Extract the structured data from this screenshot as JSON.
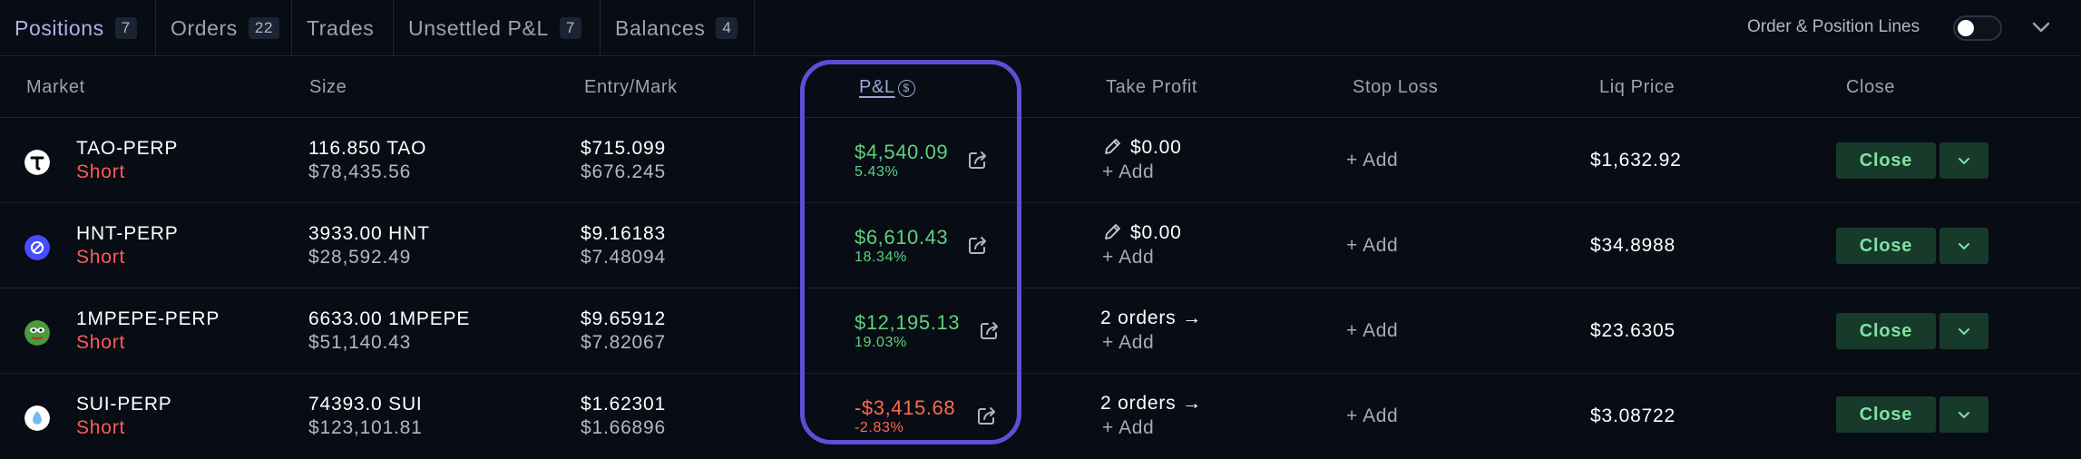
{
  "tabs": [
    {
      "label": "Positions",
      "count": "7"
    },
    {
      "label": "Orders",
      "count": "22"
    },
    {
      "label": "Trades"
    },
    {
      "label": "Unsettled P&L",
      "count": "7"
    },
    {
      "label": "Balances",
      "count": "4"
    }
  ],
  "toggle_label": "Order & Position Lines",
  "toggle_on": false,
  "columns": {
    "market": "Market",
    "size": "Size",
    "entry_mark": "Entry/Mark",
    "pnl": "P&L",
    "pnl_unit": "$",
    "take_profit": "Take Profit",
    "stop_loss": "Stop Loss",
    "liq_price": "Liq Price",
    "close": "Close"
  },
  "rows": [
    {
      "market": "TAO-PERP",
      "side": "Short",
      "size": "116.850 TAO",
      "notional": "$78,435.56",
      "entry": "$715.099",
      "mark": "$676.245",
      "pnl": "$4,540.09",
      "pnl_pct": "5.43%",
      "pnl_sign": "positive",
      "take_profit": "$0.00",
      "take_profit_add": "+ Add",
      "stop_loss": "+ Add",
      "liq_price": "$1,632.92",
      "close": "Close",
      "icon": "tao-token-icon",
      "icon_color": "#ffffff"
    },
    {
      "market": "HNT-PERP",
      "side": "Short",
      "size": "3933.00 HNT",
      "notional": "$28,592.49",
      "entry": "$9.16183",
      "mark": "$7.48094",
      "pnl": "$6,610.43",
      "pnl_pct": "18.34%",
      "pnl_sign": "positive",
      "take_profit": "$0.00",
      "take_profit_add": "+ Add",
      "stop_loss": "+ Add",
      "liq_price": "$34.8988",
      "close": "Close",
      "icon": "hnt-token-icon",
      "icon_color": "#474dff"
    },
    {
      "market": "1MPEPE-PERP",
      "side": "Short",
      "size": "6633.00 1MPEPE",
      "notional": "$51,140.43",
      "entry": "$9.65912",
      "mark": "$7.82067",
      "pnl": "$12,195.13",
      "pnl_pct": "19.03%",
      "pnl_sign": "positive",
      "take_profit": "2 orders →",
      "take_profit_add": "+ Add",
      "stop_loss": "+ Add",
      "liq_price": "$23.6305",
      "close": "Close",
      "icon": "pepe-token-icon",
      "icon_color": "#4c9a3a"
    },
    {
      "market": "SUI-PERP",
      "side": "Short",
      "size": "74393.0 SUI",
      "notional": "$123,101.81",
      "entry": "$1.62301",
      "mark": "$1.66896",
      "pnl": "-$3,415.68",
      "pnl_pct": "-2.83%",
      "pnl_sign": "negative",
      "take_profit": "2 orders →",
      "take_profit_add": "+ Add",
      "stop_loss": "+ Add",
      "liq_price": "$3.08722",
      "close": "Close",
      "icon": "sui-token-icon",
      "icon_color": "#6fbcf0"
    }
  ],
  "colors": {
    "background": "#080c14",
    "accent_tab": "#b8aee8",
    "profit": "#5fd17f",
    "loss": "#ff6a4d",
    "short": "#ff5a5a",
    "close_button_bg": "#173a2a",
    "close_button_text": "#7fe3a4",
    "highlight": "#5b4fd8"
  }
}
